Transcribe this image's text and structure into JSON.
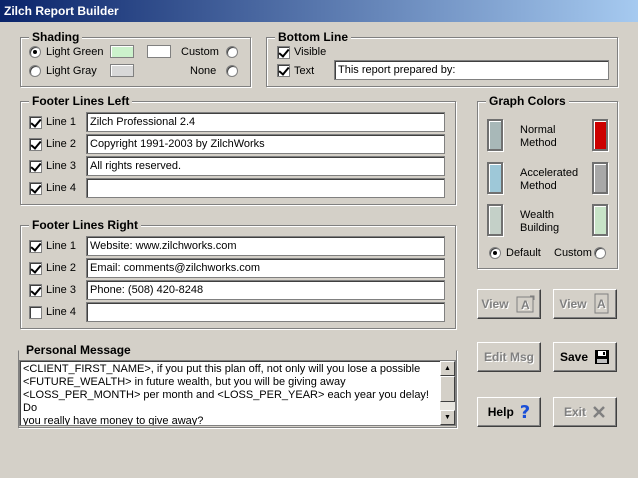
{
  "window": {
    "title": "Zilch Report Builder"
  },
  "shading": {
    "title": "Shading",
    "light_green": "Light Green",
    "light_gray": "Light Gray",
    "custom": "Custom",
    "none": "None",
    "selected": "light_green",
    "colors": {
      "light_green": "#ccf2cc",
      "light_gray": "#d8d8d8",
      "custom": "#ffffff"
    }
  },
  "bottom_line": {
    "title": "Bottom Line",
    "visible_label": "Visible",
    "visible_checked": true,
    "text_label": "Text",
    "text_checked": true,
    "text_value": "This report prepared by:"
  },
  "footer_left": {
    "title": "Footer Lines Left",
    "lines": [
      {
        "label": "Line 1",
        "checked": true,
        "value": "Zilch Professional 2.4"
      },
      {
        "label": "Line 2",
        "checked": true,
        "value": "Copyright 1991-2003 by ZilchWorks"
      },
      {
        "label": "Line 3",
        "checked": true,
        "value": "All rights reserved."
      },
      {
        "label": "Line 4",
        "checked": true,
        "value": ""
      }
    ]
  },
  "footer_right": {
    "title": "Footer Lines Right",
    "lines": [
      {
        "label": "Line 1",
        "checked": true,
        "value": "Website: www.zilchworks.com"
      },
      {
        "label": "Line 2",
        "checked": true,
        "value": "Email: comments@zilchworks.com"
      },
      {
        "label": "Line 3",
        "checked": true,
        "value": "Phone: (508) 420-8248"
      },
      {
        "label": "Line 4",
        "checked": false,
        "value": ""
      }
    ]
  },
  "graph_colors": {
    "title": "Graph Colors",
    "rows": [
      {
        "label": "Normal Method",
        "line1": "Normal",
        "line2": "Method",
        "default_color": "#a8b8b8",
        "custom_color": "#cc0000"
      },
      {
        "label": "Accelerated Method",
        "line1": "Accelerated",
        "line2": "Method",
        "default_color": "#9ec8d8",
        "custom_color": "#a8a8a8"
      },
      {
        "label": "Wealth Building",
        "line1": "Wealth",
        "line2": "Building",
        "default_color": "#c4d0c8",
        "custom_color": "#c8e4c8"
      }
    ],
    "default_label": "Default",
    "custom_label": "Custom",
    "selected": "default"
  },
  "buttons": {
    "view1": "View",
    "view2": "View",
    "edit_msg": "Edit Msg",
    "save": "Save",
    "help": "Help",
    "exit": "Exit"
  },
  "personal_message": {
    "title": "Personal Message",
    "lines": [
      "<CLIENT_FIRST_NAME>, if you put this plan off, not  only will you lose a possible",
      "<FUTURE_WEALTH> in future wealth, but you will be giving away",
      "<LOSS_PER_MONTH> per month and <LOSS_PER_YEAR> each year you delay! Do",
      "you really have money to give away?"
    ]
  }
}
